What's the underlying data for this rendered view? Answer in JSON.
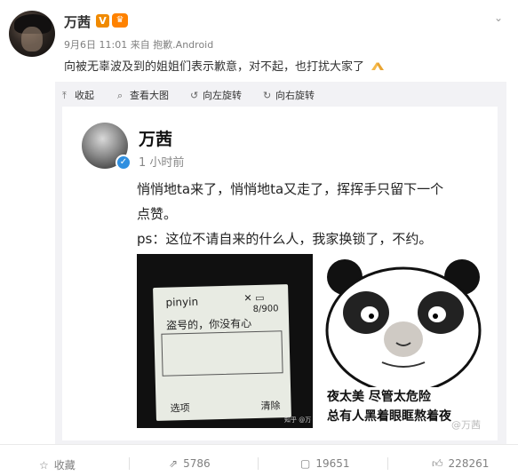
{
  "post": {
    "author": "万茜",
    "meta": "9月6日 11:01 来自 抱歉.Android",
    "text": "向被无辜波及到的姐姐们表示歉意，对不起，也打扰大家了"
  },
  "toolbar": {
    "collapse": "收起",
    "view_large": "查看大图",
    "rotate_left": "向左旋转",
    "rotate_right": "向右旋转"
  },
  "image": {
    "inner_name": "万茜",
    "inner_time": "1 小时前",
    "line1": "悄悄地ta来了，悄悄地ta又走了，挥挥手只留下一个",
    "line2": "点赞。",
    "line3": "ps：这位不请自来的什么人，我家换锁了，不约。",
    "phone": {
      "input_mode": "pinyin",
      "counter": "8/900",
      "message": "盗号的，你没有心",
      "left_softkey": "选项",
      "right_softkey": "清除",
      "watermark": "知乎 @万"
    },
    "panda_caption1": "夜太美 尽管太危险",
    "panda_caption2": "总有人黑着眼眶熬着夜",
    "watermark": "@万茜"
  },
  "actions": {
    "favorite": "收藏",
    "repost": "5786",
    "comment": "19651",
    "like": "228261"
  }
}
